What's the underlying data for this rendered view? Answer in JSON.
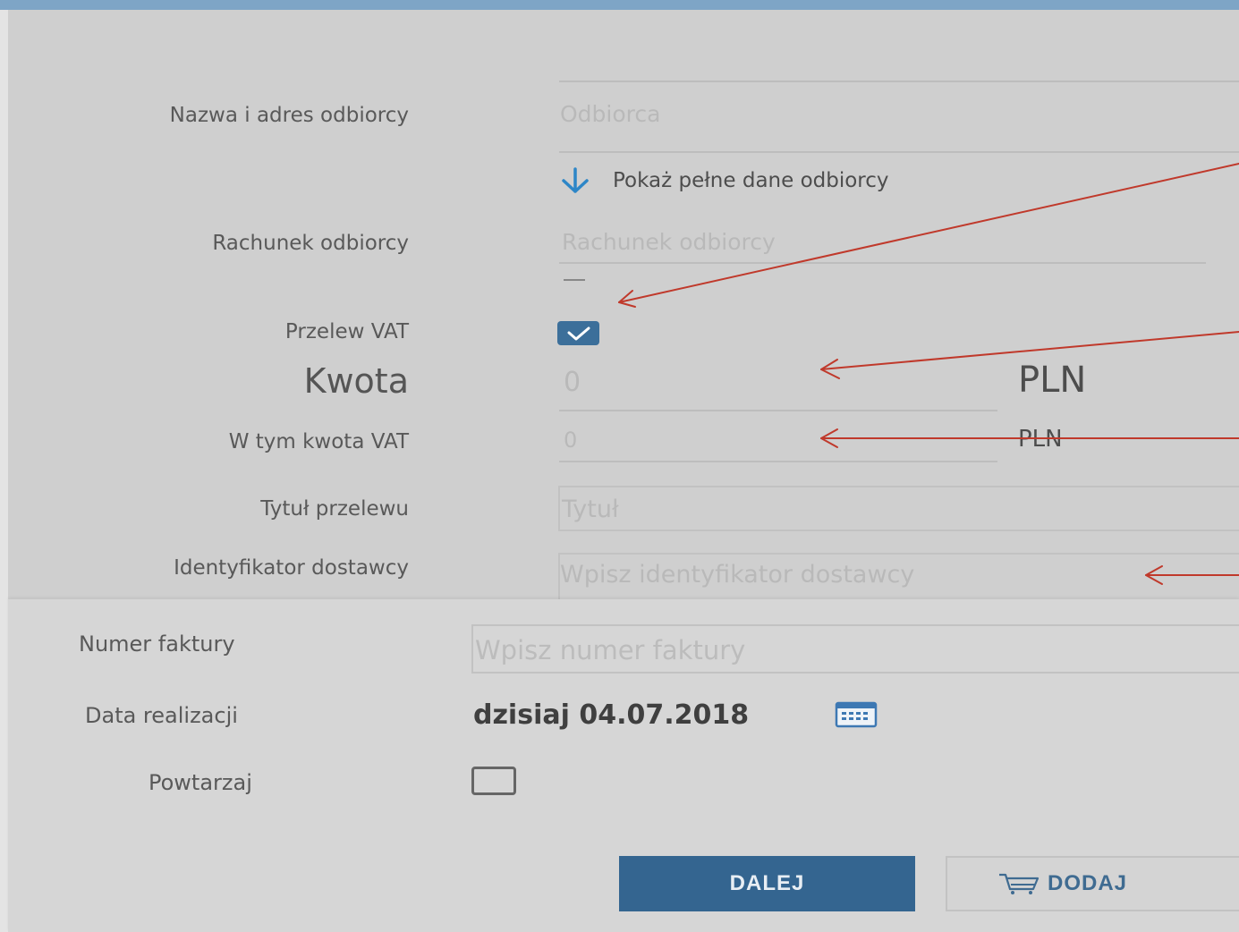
{
  "recipient": {
    "name_label": "Nazwa i adres odbiorcy",
    "name_placeholder": "Odbiorca",
    "show_full_link": "Pokaż pełne dane odbiorcy",
    "account_label": "Rachunek odbiorcy",
    "account_placeholder": "Rachunek odbiorcy"
  },
  "vat": {
    "label": "Przelew VAT",
    "checked": true
  },
  "amount": {
    "label": "Kwota",
    "value": "0",
    "currency": "PLN"
  },
  "vat_amount": {
    "label": "W tym kwota VAT",
    "value": "0",
    "currency": "PLN"
  },
  "title": {
    "label": "Tytuł przelewu",
    "placeholder": "Tytuł"
  },
  "supplier_id": {
    "label": "Identyfikator dostawcy",
    "placeholder": "Wpisz identyfikator dostawcy"
  },
  "invoice": {
    "label": "Numer faktury",
    "placeholder": "Wpisz numer faktury"
  },
  "execution_date": {
    "label": "Data realizacji",
    "value": "dzisiaj 04.07.2018"
  },
  "repeat": {
    "label": "Powtarzaj",
    "checked": false
  },
  "buttons": {
    "next": "DALEJ",
    "add": "DODAJ"
  },
  "colors": {
    "accent": "#346590",
    "annotation_arrow": "#c0392b",
    "panel_background": "#cfcfcf"
  },
  "icons": {
    "show_more": "arrow-down-icon",
    "checkbox": "check-icon",
    "calendar": "calendar-icon",
    "add": "cart-icon"
  }
}
